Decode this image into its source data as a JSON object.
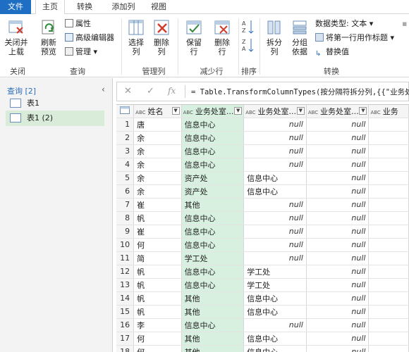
{
  "tabs": [
    {
      "label": "文件"
    },
    {
      "label": "主页"
    },
    {
      "label": "转换"
    },
    {
      "label": "添加列"
    },
    {
      "label": "视图"
    }
  ],
  "ribbon": {
    "close_load": "关闭并\n上载",
    "refresh_preview": "刷新\n预览",
    "properties": "属性",
    "advanced_editor": "高级编辑器",
    "manage": "管理",
    "choose_columns": "选择\n列",
    "remove_columns": "删除\n列",
    "keep_rows": "保留\n行",
    "remove_rows": "删除\n行",
    "split_column": "拆分\n列",
    "group_by": "分组\n依据",
    "data_type": "数据类型: 文本",
    "first_row_header": "将第一行用作标题",
    "replace_values": "替换值",
    "groups": {
      "close": "关闭",
      "query": "查询",
      "manage_columns": "管理列",
      "reduce_rows": "减少行",
      "sort": "排序",
      "transform": "转换"
    }
  },
  "queries": {
    "header": "查询 [2]",
    "items": [
      {
        "label": "表1"
      },
      {
        "label": "表1 (2)"
      }
    ]
  },
  "formula": {
    "text": "= Table.TransformColumnTypes(按分隔符拆分列,{{\"业务处室"
  },
  "table": {
    "columns": [
      "姓名",
      "业务处室...",
      "业务处室...",
      "业务处室...",
      "业务"
    ],
    "rows": [
      {
        "n": "1",
        "name": "唐",
        "c1": "信息中心",
        "c2": "null",
        "c3": "null"
      },
      {
        "n": "2",
        "name": "余",
        "c1": "信息中心",
        "c2": "null",
        "c3": "null"
      },
      {
        "n": "3",
        "name": "余",
        "c1": "信息中心",
        "c2": "null",
        "c3": "null"
      },
      {
        "n": "4",
        "name": "余",
        "c1": "信息中心",
        "c2": "null",
        "c3": "null"
      },
      {
        "n": "5",
        "name": "余",
        "c1": "资产处",
        "c2": "信息中心",
        "c3": "null"
      },
      {
        "n": "6",
        "name": "余",
        "c1": "资产处",
        "c2": "信息中心",
        "c3": "null"
      },
      {
        "n": "7",
        "name": "崔",
        "c1": "其他",
        "c2": "null",
        "c3": "null"
      },
      {
        "n": "8",
        "name": "帆",
        "c1": "信息中心",
        "c2": "null",
        "c3": "null"
      },
      {
        "n": "9",
        "name": "崔",
        "c1": "信息中心",
        "c2": "null",
        "c3": "null"
      },
      {
        "n": "10",
        "name": "何",
        "c1": "信息中心",
        "c2": "null",
        "c3": "null"
      },
      {
        "n": "11",
        "name": "简",
        "c1": "学工处",
        "c2": "null",
        "c3": "null"
      },
      {
        "n": "12",
        "name": "帆",
        "c1": "信息中心",
        "c2": "学工处",
        "c3": "null"
      },
      {
        "n": "13",
        "name": "帆",
        "c1": "信息中心",
        "c2": "学工处",
        "c3": "null"
      },
      {
        "n": "14",
        "name": "帆",
        "c1": "其他",
        "c2": "信息中心",
        "c3": "null"
      },
      {
        "n": "15",
        "name": "帆",
        "c1": "其他",
        "c2": "信息中心",
        "c3": "null"
      },
      {
        "n": "16",
        "name": "李",
        "c1": "信息中心",
        "c2": "null",
        "c3": "null"
      },
      {
        "n": "17",
        "name": "何",
        "c1": "其他",
        "c2": "信息中心",
        "c3": "null"
      },
      {
        "n": "18",
        "name": "何",
        "c1": "其他",
        "c2": "信息中心",
        "c3": "null"
      }
    ]
  }
}
